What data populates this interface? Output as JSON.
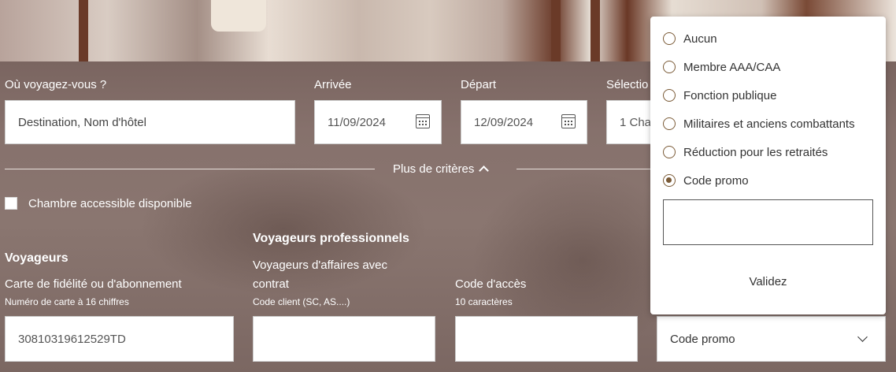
{
  "search": {
    "destination_label": "Où voyagez-vous ?",
    "destination_placeholder": "Destination, Nom d'hôtel",
    "arrival_label": "Arrivée",
    "arrival_value": "11/09/2024",
    "departure_label": "Départ",
    "departure_value": "12/09/2024",
    "rooms_label": "Sélectio",
    "rooms_value": "1 Cha"
  },
  "more_criteria": {
    "label": "Plus de critères",
    "icon": "chevron-up-icon"
  },
  "accessible": {
    "label": "Chambre accessible disponible"
  },
  "travelers": {
    "heading": "Voyageurs",
    "loyalty_label": "Carte de fidélité ou d'abonnement",
    "loyalty_hint": "Numéro de carte à 16 chiffres",
    "loyalty_value": "30810319612529TD"
  },
  "business": {
    "heading": "Voyageurs professionnels",
    "contract_label_line1": "Voyageurs d'affaires avec",
    "contract_label_line2": "contrat",
    "contract_hint": "Code client (SC, AS....)",
    "contract_value": ""
  },
  "access_code": {
    "label": "Code d'accès",
    "hint": "10 caractères",
    "value": ""
  },
  "rate_dropdown": {
    "selected": "Code promo",
    "options": [
      {
        "label": "Aucun",
        "checked": false
      },
      {
        "label": "Membre AAA/CAA",
        "checked": false
      },
      {
        "label": "Fonction publique",
        "checked": false
      },
      {
        "label": "Militaires et anciens combattants",
        "checked": false
      },
      {
        "label": "Réduction pour les retraités",
        "checked": false
      },
      {
        "label": "Code promo",
        "checked": true
      }
    ],
    "promo_input_value": "",
    "validate_label": "Validez"
  },
  "colors": {
    "accent": "#7a5a36",
    "overlay": "#7a6560"
  }
}
